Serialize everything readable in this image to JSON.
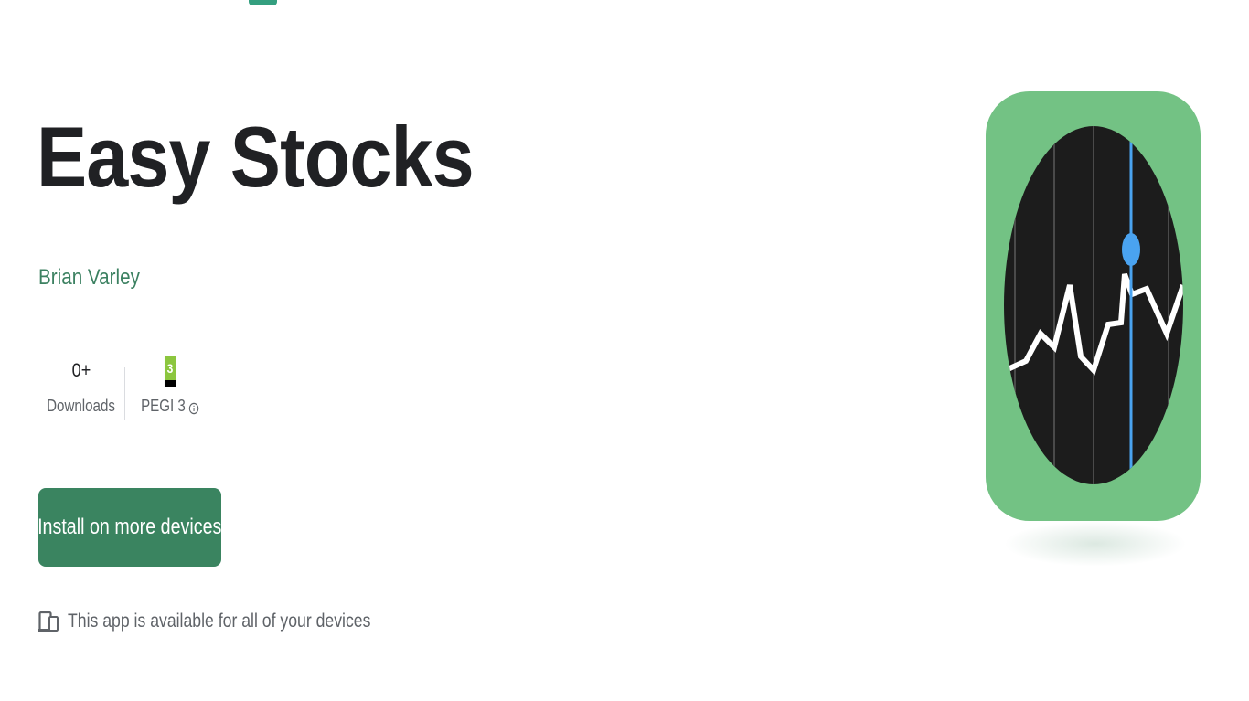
{
  "app": {
    "title": "Easy Stocks",
    "developer": "Brian Varley"
  },
  "stats": {
    "downloads_value": "0+",
    "downloads_label": "Downloads",
    "rating_badge_number": "3",
    "rating_label": "PEGI 3"
  },
  "actions": {
    "install_label": "Install on more devices"
  },
  "availability": {
    "text": "This app is available for all of your devices"
  },
  "icons": {
    "info": "info-icon",
    "devices": "devices-icon",
    "app_logo": "stock-chart-logo"
  },
  "colors": {
    "accent": "#01875f",
    "developer": "#3c8161",
    "button": "#3a8460",
    "logo_background": "#73c284",
    "logo_screen": "#1c1c1c",
    "logo_marker": "#4aa3f0",
    "pegi_green": "#8cc63e"
  }
}
